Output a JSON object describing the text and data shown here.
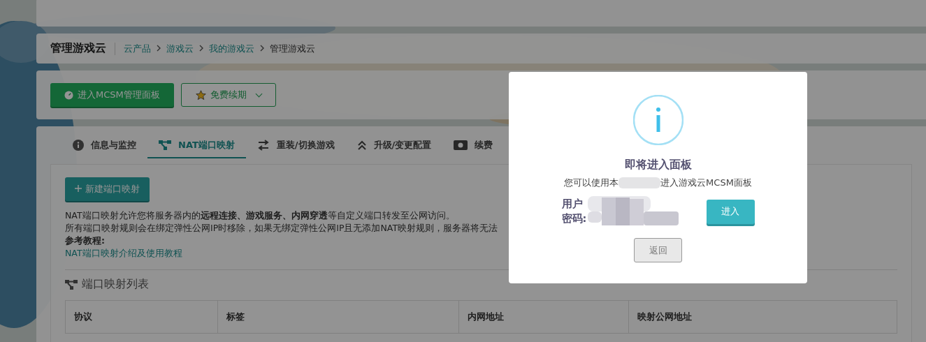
{
  "header": {
    "title": "管理游戏云",
    "breadcrumb": [
      "云产品",
      "游戏云",
      "我的游戏云",
      "管理游戏云"
    ]
  },
  "actions": [
    {
      "kind": "primary",
      "label": "进入MCSM管理面板"
    },
    {
      "kind": "dropdown",
      "label": "免费续期"
    }
  ],
  "tabs": [
    {
      "label": "信息与监控",
      "selected": false
    },
    {
      "label": "NAT端口映射",
      "selected": true
    },
    {
      "label": "重装/切换游戏",
      "selected": false
    },
    {
      "label": "升级/变更配置",
      "selected": false
    },
    {
      "label": "续费",
      "selected": false
    }
  ],
  "nat": {
    "new_button": "新建端口映射",
    "description": [
      "NAT端口映射允许您将服务器内的**远程连接、游戏服务、内网穿透**等自定义端口转发至公网访问。",
      "所有端口映射规则会在绑定弹性公网IP时移除，如果无绑定弹性公网IP且无添加NAT映射规则，服务器将无法"
    ],
    "reference_label": "参考教程:",
    "reference_link": "NAT端口映射介绍及使用教程",
    "list_title": "端口映射列表",
    "table": {
      "columns": [
        "协议",
        "标签",
        "内网地址",
        "映射公网地址"
      ]
    }
  },
  "modal": {
    "title": "即将进入面板",
    "message_start": "您可以使用本",
    "message_end": "进入游戏云MCSM面板",
    "username_label": "用户",
    "password_label": "密码:",
    "enter_button": "进入",
    "back_button": "返回"
  }
}
